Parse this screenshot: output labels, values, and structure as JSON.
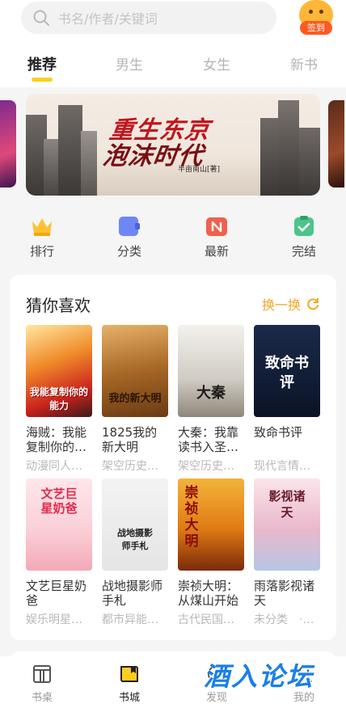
{
  "search": {
    "placeholder": "书名/作者/关键词"
  },
  "checkin": {
    "label": "签到"
  },
  "tabs": [
    {
      "label": "推荐",
      "active": true
    },
    {
      "label": "男生"
    },
    {
      "label": "女生"
    },
    {
      "label": "新书"
    }
  ],
  "banner": {
    "title_line1": "重生东京",
    "title_line2": "泡沫时代",
    "author": "半亩南山[著]"
  },
  "categories": [
    {
      "label": "排行",
      "icon": "crown-icon",
      "color": "#ffc233"
    },
    {
      "label": "分类",
      "icon": "category-icon",
      "color": "#6f86f5"
    },
    {
      "label": "最新",
      "icon": "new-icon",
      "color": "#f0604d"
    },
    {
      "label": "完结",
      "icon": "completed-icon",
      "color": "#4cc48a"
    }
  ],
  "recommend": {
    "title": "猜你喜欢",
    "refresh_label": "换一换",
    "books": [
      {
        "name": "海贼：我能复制你的…",
        "tag": "动漫同人…",
        "cover_text": "我能复制你的能力"
      },
      {
        "name": "1825我的新大明",
        "tag": "架空历史…",
        "cover_text": "我的新大明"
      },
      {
        "name": "大秦：我靠读书入圣…",
        "tag": "架空历史…",
        "cover_text": "大秦"
      },
      {
        "name": "致命书评",
        "tag": "现代言情…",
        "cover_text": "致命书评"
      },
      {
        "name": "文艺巨星奶爸",
        "tag": "娱乐明星…",
        "cover_text": "文艺巨星奶爸"
      },
      {
        "name": "战地摄影师手札",
        "tag": "都市异能…",
        "cover_text": "战地摄影师手札"
      },
      {
        "name": "崇祯大明：从煤山开始",
        "tag": "古代民国…",
        "cover_text": "崇祯大明"
      },
      {
        "name": "雨落影视诸天",
        "tag": "未分类　·…",
        "cover_text": "影视诸天"
      }
    ]
  },
  "nav": [
    {
      "label": "书桌",
      "icon": "desk-icon"
    },
    {
      "label": "书城",
      "icon": "bookstore-icon",
      "active": true
    },
    {
      "label": "发现",
      "icon": "discover-icon"
    },
    {
      "label": "我的",
      "icon": "profile-icon"
    }
  ],
  "watermark": "酒入论坛"
}
